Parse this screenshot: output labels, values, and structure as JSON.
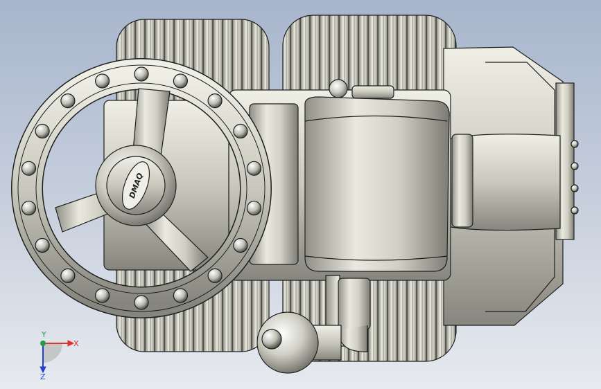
{
  "viewport": {
    "background_top": "#a7b5cc",
    "background_bottom": "#e7eaef",
    "model_color": "#cfcfc2",
    "edge_color": "#1e1e1e"
  },
  "model": {
    "hub_logo_text": "DMAQ"
  },
  "triad": {
    "x_label": "X",
    "y_label": "Y",
    "z_label": "Z",
    "x_color": "#e03030",
    "y_color": "#20a040",
    "z_color": "#2040d0"
  }
}
